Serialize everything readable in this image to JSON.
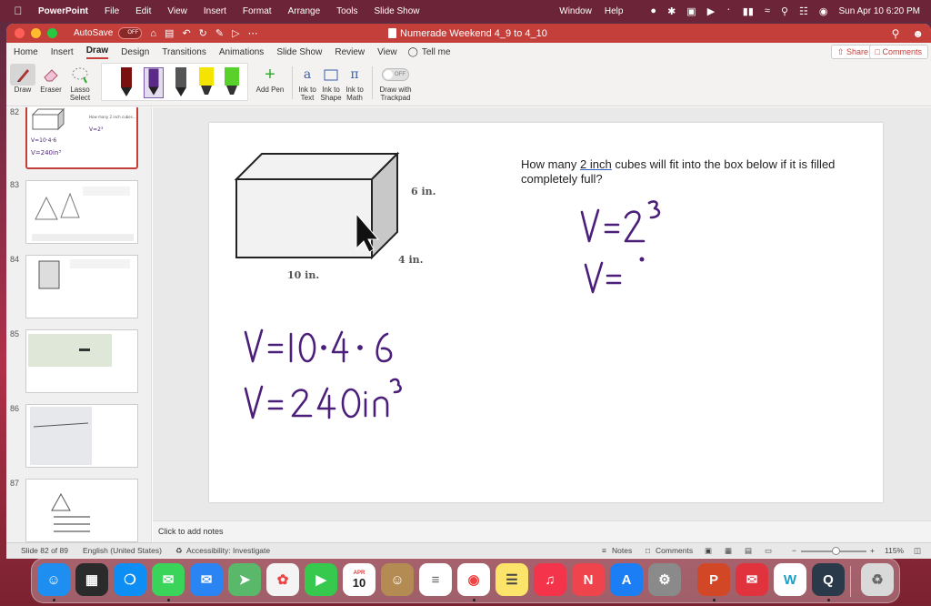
{
  "menubar": {
    "app": "PowerPoint",
    "menus": [
      "File",
      "Edit",
      "View",
      "Insert",
      "Format",
      "Arrange",
      "Tools",
      "Slide Show"
    ],
    "right_menus": [
      "Window",
      "Help"
    ],
    "clock": "Sun Apr 10  6:20 PM"
  },
  "titlebar": {
    "autosave": "AutoSave",
    "autosave_state": "OFF",
    "title": "Numerade Weekend 4_9 to 4_10"
  },
  "ribbon": {
    "tabs": [
      "Home",
      "Insert",
      "Draw",
      "Design",
      "Transitions",
      "Animations",
      "Slide Show",
      "Review",
      "View",
      "Tell me"
    ],
    "active_tab": "Draw",
    "share": "Share",
    "comments": "Comments",
    "tools": {
      "draw": "Draw",
      "eraser": "Eraser",
      "lasso": "Lasso Select",
      "add_pen": "Add Pen",
      "ink_to_text": "Ink to Text",
      "ink_to_shape": "Ink to Shape",
      "ink_to_math": "Ink to Math",
      "trackpad": "Draw with Trackpad",
      "trackpad_state": "OFF"
    },
    "pen_colors": [
      "#7a1010",
      "#5b2a86",
      "#555555",
      "#f5e400",
      "#5ad02a"
    ]
  },
  "thumbnails": [
    {
      "num": "82",
      "selected": true
    },
    {
      "num": "83",
      "selected": false
    },
    {
      "num": "84",
      "selected": false
    },
    {
      "num": "85",
      "selected": false
    },
    {
      "num": "86",
      "selected": false
    },
    {
      "num": "87",
      "selected": false
    }
  ],
  "slide": {
    "question_pre": "How many ",
    "question_link": "2 inch",
    "question_post": " cubes will fit into the box below if it is filled completely full?",
    "dim_height": "6 in.",
    "dim_depth": "4 in.",
    "dim_length": "10 in.",
    "ink": {
      "line1": "V= 10·4·6",
      "line2": "V= 240in³",
      "line3": "V= 2³",
      "line4": "V="
    },
    "ink_color": "#4b1e7a"
  },
  "notes_placeholder": "Click to add notes",
  "status": {
    "slide": "Slide 82 of 89",
    "language": "English (United States)",
    "accessibility": "Accessibility: Investigate",
    "notes": "Notes",
    "comments": "Comments",
    "zoom": "115%"
  },
  "dock": {
    "calendar_month": "APR",
    "calendar_day": "10"
  }
}
